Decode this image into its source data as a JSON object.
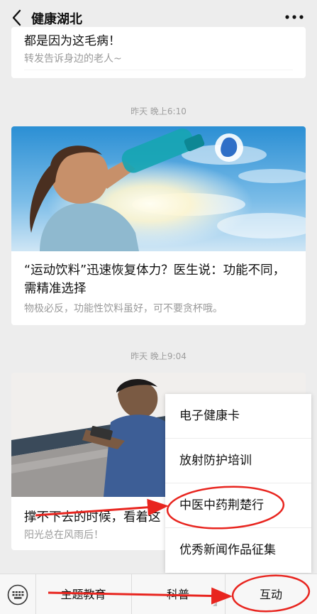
{
  "header": {
    "title": "健康湖北"
  },
  "articles": [
    {
      "title": "都是因为这毛病！",
      "summary": "转发告诉身边的老人~"
    },
    {
      "timestamp": "昨天 晚上6:10",
      "title": "“运动饮料”迅速恢复体力？医生说：功能不同，需精准选择",
      "summary": "物极必反，功能性饮料虽好，可不要贪杯哦。"
    },
    {
      "timestamp": "昨天 晚上9:04",
      "title": "撑不下去的时候，看着这",
      "summary": "阳光总在风雨后！"
    }
  ],
  "menu_popup": {
    "items": [
      "电子健康卡",
      "放射防护培训",
      "中医中药荆楚行",
      "优秀新闻作品征集"
    ]
  },
  "bottom_bar": {
    "tabs": [
      "主题教育",
      "科普",
      "互动"
    ]
  },
  "colors": {
    "annotation_red": "#e8251f",
    "background": "#ededed"
  }
}
